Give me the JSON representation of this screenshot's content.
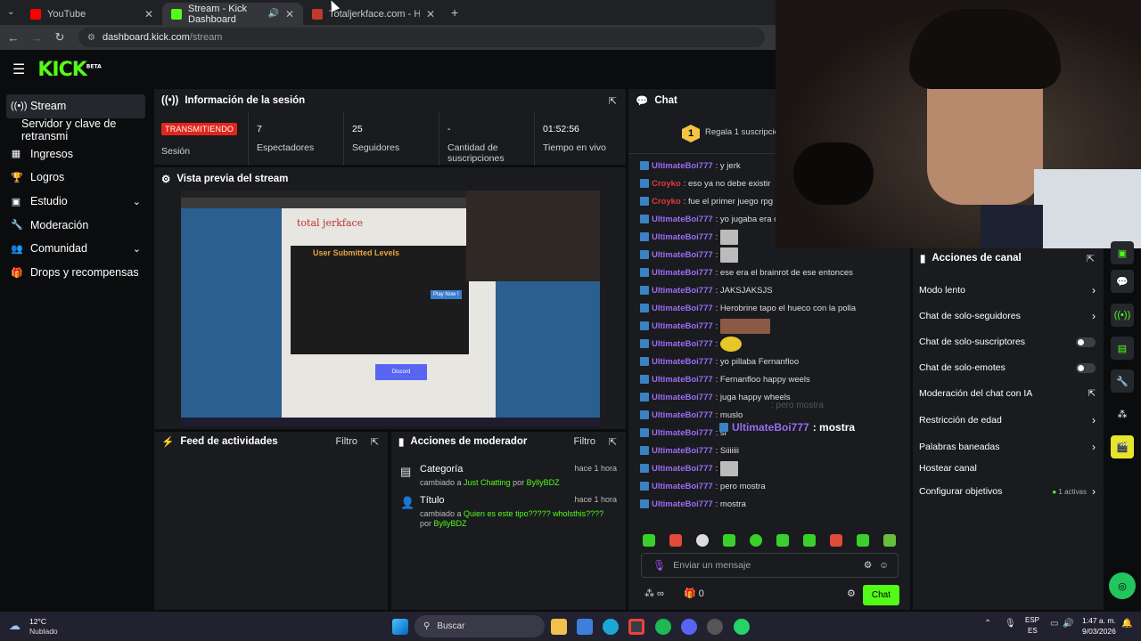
{
  "browser": {
    "tabs": [
      {
        "title": "YouTube",
        "color": "#ff0000",
        "active": false
      },
      {
        "title": "Stream - Kick Dashboard",
        "color": "#53fc18",
        "active": true
      },
      {
        "title": "Totaljerkface.com - Home Of H...",
        "color": "#c0392b",
        "active": false
      }
    ],
    "new_tab": "+",
    "url_domain": "dashboard.kick.com",
    "url_path": "/stream"
  },
  "kick": {
    "logo": "KICK",
    "beta": "BETA"
  },
  "sidebar": {
    "items": [
      {
        "label": "Stream",
        "icon": "broadcast-icon"
      },
      {
        "label": "Servidor y clave de retransmi",
        "icon": ""
      },
      {
        "label": "Ingresos",
        "icon": "chart-icon"
      },
      {
        "label": "Logros",
        "icon": "trophy-icon"
      },
      {
        "label": "Estudio",
        "icon": "studio-icon",
        "chevron": true
      },
      {
        "label": "Moderación",
        "icon": "wrench-icon"
      },
      {
        "label": "Comunidad",
        "icon": "community-icon",
        "chevron": true
      },
      {
        "label": "Drops y recompensas",
        "icon": "gift-icon"
      }
    ]
  },
  "session": {
    "title": "Información de la sesión",
    "live_badge": "TRANSMITIENDO",
    "live_label": "Sesión",
    "stats": [
      {
        "value": "7",
        "label": "Espectadores"
      },
      {
        "value": "25",
        "label": "Seguidores"
      },
      {
        "value": "-",
        "label": "Cantidad de suscripciones"
      },
      {
        "value": "01:52:56",
        "label": "Tiempo en vivo"
      }
    ]
  },
  "preview": {
    "title": "Vista previa del stream",
    "site_title": "total jerkface",
    "section": "User Submitted Levels",
    "play": "Play Now !",
    "discord": "Discord"
  },
  "activity": {
    "title": "Feed de actividades",
    "filter": "Filtro"
  },
  "mod_actions": {
    "title": "Acciones de moderador",
    "filter": "Filtro",
    "items": [
      {
        "title": "Categoría",
        "time": "hace 1 hora",
        "prefix": "cambiado a ",
        "value": "Just Chatting",
        "by": " por ",
        "user": "ByllyBDZ"
      },
      {
        "title": "Título",
        "time": "hace 1 hora",
        "prefix": "cambiado a ",
        "value": "Quien es este tipo????? wholsthis????",
        "by": " por ",
        "user": "ByllyBDZ"
      }
    ]
  },
  "chat": {
    "title": "Chat",
    "gift_text": "Regala 1 suscripción",
    "messages": [
      {
        "user": "UltimateBoi777",
        "text": ": y jerk"
      },
      {
        "user": "Croyko",
        "text": ": eso ya no debe existir",
        "red": true
      },
      {
        "user": "Croyko",
        "text": ": fue el primer juego rpg c",
        "red": true
      },
      {
        "user": "UltimateBoi777",
        "text": ": yo jugaba era c"
      },
      {
        "user": "UltimateBoi777",
        "text": ":",
        "thumb": "sm"
      },
      {
        "user": "UltimateBoi777",
        "text": ":",
        "thumb": "sm"
      },
      {
        "user": "UltimateBoi777",
        "text": ": ese era el brainrot de ese entonces"
      },
      {
        "user": "UltimateBoi777",
        "text": ": JAKSJAKSJS"
      },
      {
        "user": "UltimateBoi777",
        "text": ": Herobrine tapo el hueco con la polla"
      },
      {
        "user": "UltimateBoi777",
        "text": ":",
        "thumb": "wide"
      },
      {
        "user": "UltimateBoi777",
        "text": ":",
        "thumb": "emoji"
      },
      {
        "user": "UltimateBoi777",
        "text": ": yo pillaba Fernanfloo"
      },
      {
        "user": "UltimateBoi777",
        "text": ": Fernanfloo happy weels"
      },
      {
        "user": "UltimateBoi777",
        "text": ": juga happy wheels"
      },
      {
        "user": "UltimateBoi777",
        "text": ": muslo"
      },
      {
        "user": "UltimateBoi777",
        "text": ": si"
      },
      {
        "user": "UltimateBoi777",
        "text": ": Siiiiiii"
      },
      {
        "user": "UltimateBoi777",
        "text": ":",
        "thumb": "sm"
      },
      {
        "user": "UltimateBoi777",
        "text": ": pero mostra"
      },
      {
        "user": "UltimateBoi777",
        "text": ": mostra"
      }
    ],
    "overlay_user": "UltimateBoi777",
    "overlay_text": ": mostra",
    "overlay_ghost": ": pero mostra",
    "input_placeholder": "Enviar un mensaje",
    "count": "0",
    "send": "Chat"
  },
  "channel_actions": {
    "title": "Acciones de canal",
    "items": [
      {
        "label": "Modo lento",
        "type": "arrow"
      },
      {
        "label": "Chat de solo-seguidores",
        "type": "arrow"
      },
      {
        "label": "Chat de solo-suscriptores",
        "type": "toggle"
      },
      {
        "label": "Chat de solo-emotes",
        "type": "toggle"
      },
      {
        "label": "Moderación del chat con IA",
        "type": "link"
      },
      {
        "label": "Restricción de edad",
        "type": "arrow"
      },
      {
        "label": "Palabras baneadas",
        "type": "arrow"
      },
      {
        "label": "Hostear canal",
        "type": "none"
      },
      {
        "label": "Configurar objetivos",
        "type": "arrow",
        "extra": "1 activas"
      }
    ]
  },
  "taskbar": {
    "temp": "12°C",
    "weather": "Nublado",
    "search": "Buscar",
    "lang1": "ESP",
    "lang2": "ES",
    "time": "1:47 a. m.",
    "date": "9/03/2026"
  }
}
